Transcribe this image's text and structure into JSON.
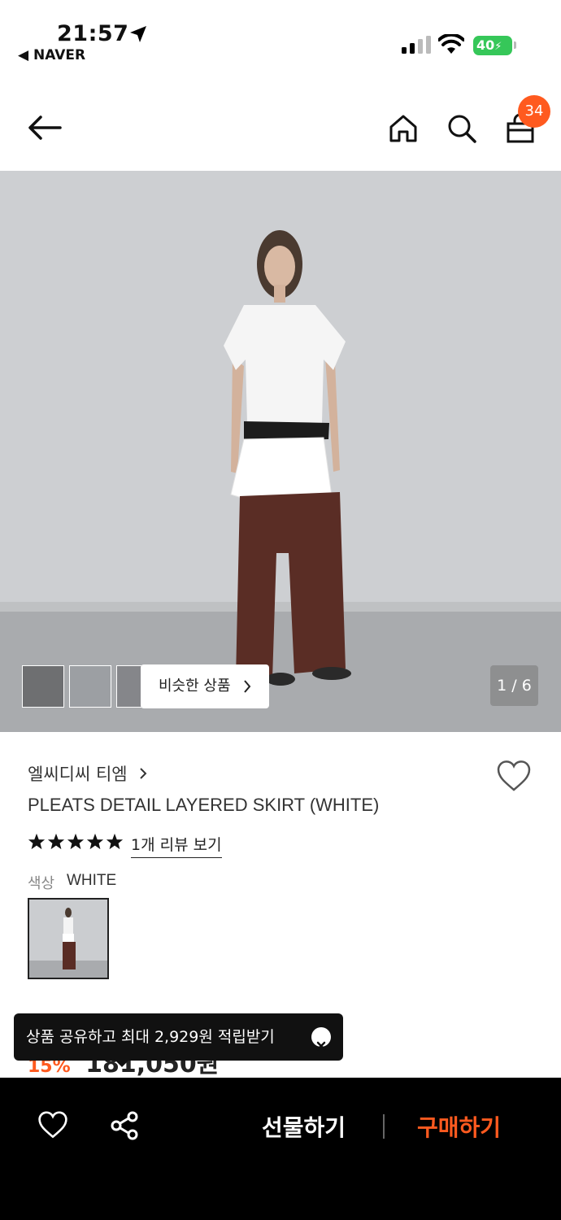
{
  "status_bar": {
    "time": "21:57",
    "back_app": "◀ NAVER",
    "battery": "40"
  },
  "nav": {
    "cart_count": "34"
  },
  "gallery": {
    "similar_label": "비슷한 상품",
    "page_indicator": "1 / 6"
  },
  "product": {
    "brand": "엘씨디씨 티엠",
    "title": "PLEATS DETAIL LAYERED SKIRT (WHITE)",
    "rating_stars": 5,
    "review_link": "1개 리뷰 보기",
    "color_label": "색상",
    "color_value": "WHITE"
  },
  "price": {
    "discount": "15%",
    "amount": "181,050원"
  },
  "toast": {
    "message": "상품 공유하고 최대 2,929원 적립받기"
  },
  "bottom_bar": {
    "gift_label": "선물하기",
    "buy_label": "구매하기"
  },
  "colors": {
    "accent": "#ff5a1f",
    "battery": "#36c759"
  },
  "icons": [
    "location-arrow-icon",
    "signal-icon",
    "wifi-icon",
    "battery-icon",
    "back-arrow-icon",
    "home-icon",
    "search-icon",
    "shopping-bag-icon",
    "chevron-right-icon",
    "heart-icon",
    "star-icon",
    "close-icon",
    "share-icon"
  ]
}
